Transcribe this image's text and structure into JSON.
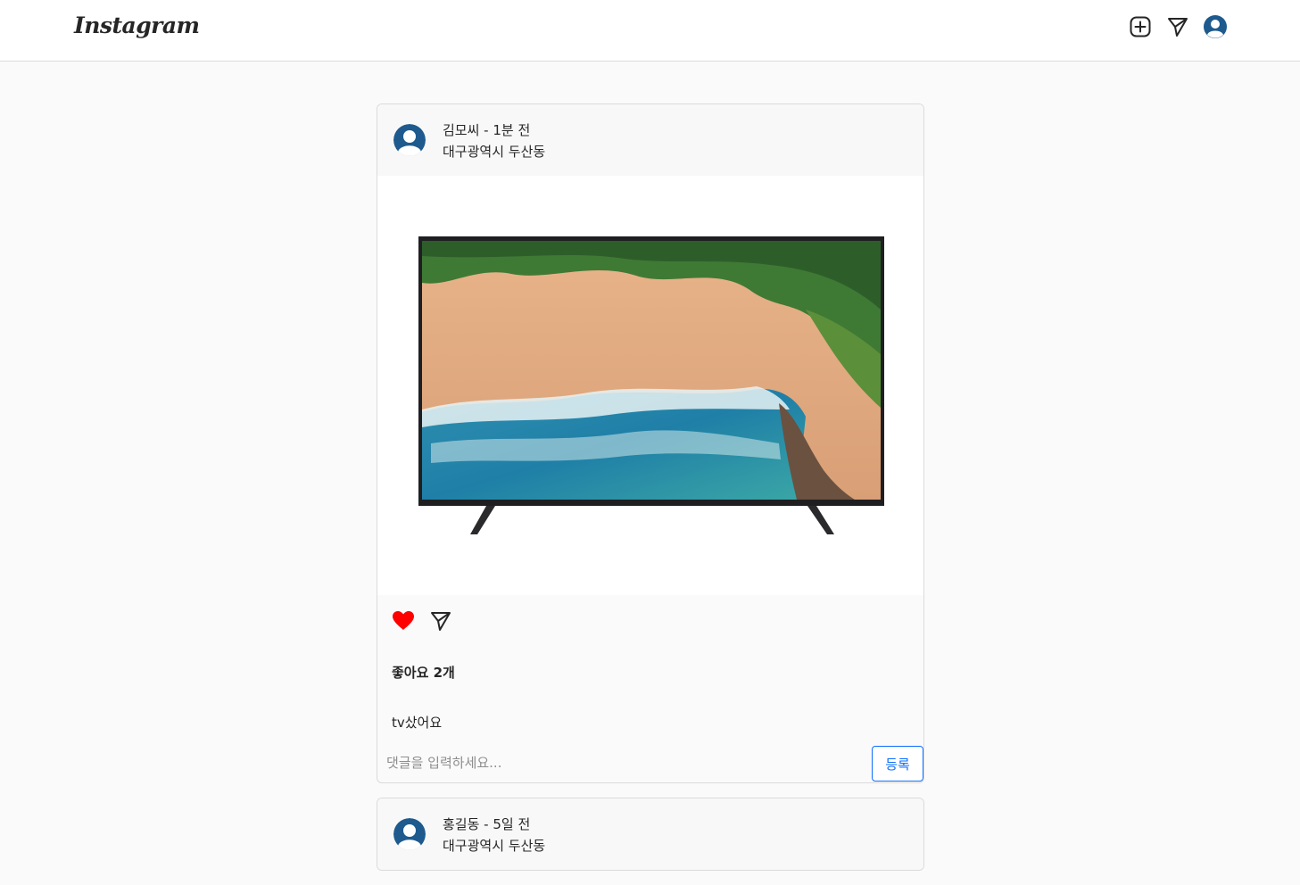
{
  "nav": {
    "logo": "Instagram",
    "icons": [
      "add-post-icon",
      "send-icon",
      "profile-avatar-icon"
    ]
  },
  "colors": {
    "avatar": "#1e5a8e",
    "like": "#ff0000",
    "accent": "#0d6efd"
  },
  "posts": [
    {
      "header": "김모씨 - 1분 전",
      "location": "대구광역시 두산동",
      "liked": true,
      "likes_text": "좋아요 2개",
      "caption": "tv샀어요",
      "comment_placeholder": "댓글을 입력하세요...",
      "submit_label": "등록"
    },
    {
      "header": "홍길동 - 5일 전",
      "location": "대구광역시 두산동"
    }
  ]
}
